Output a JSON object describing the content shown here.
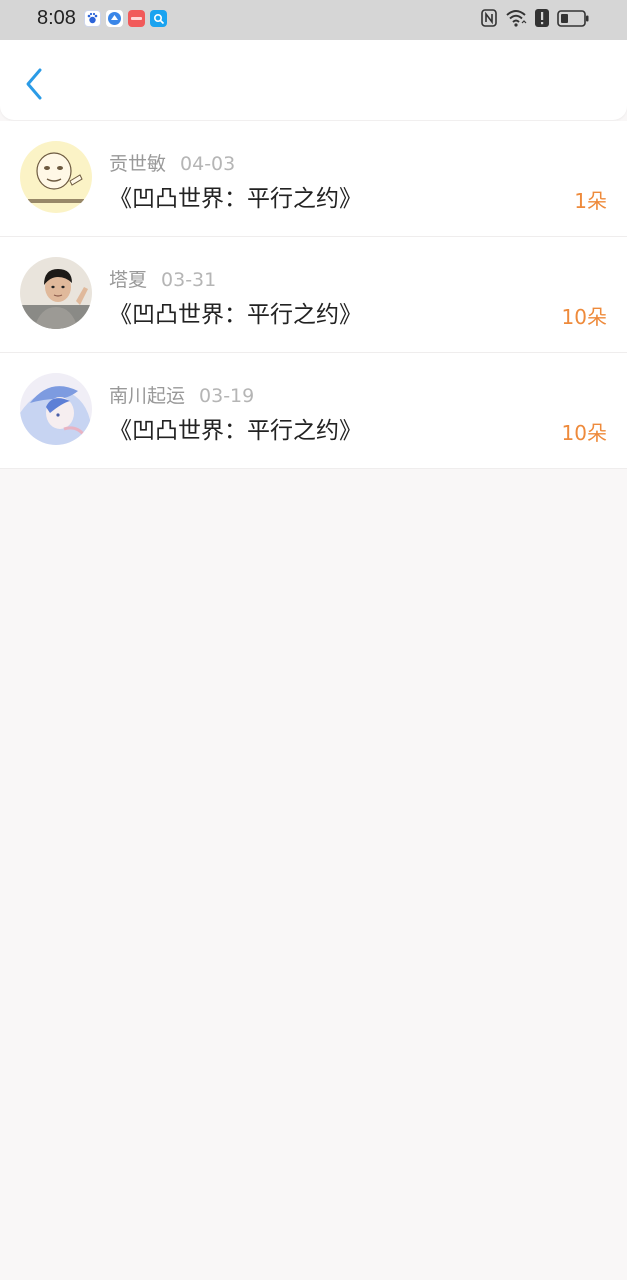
{
  "status_bar": {
    "time": "8:08",
    "notification_icons": [
      "baidu-icon",
      "blue-app-icon",
      "red-app-icon",
      "search-app-icon"
    ],
    "right_icons": [
      "nfc-icon",
      "wifi-icon",
      "alert-icon",
      "battery-icon"
    ]
  },
  "header": {
    "back_icon": "chevron-left-icon",
    "accent_color": "#2b9be6"
  },
  "list": {
    "count_color": "#ee8a3b",
    "items": [
      {
        "name": "贡世敏",
        "date": "04-03",
        "title": "《凹凸世界：平行之约》",
        "count": "1朵"
      },
      {
        "name": "塔夏",
        "date": "03-31",
        "title": "《凹凸世界：平行之约》",
        "count": "10朵"
      },
      {
        "name": "南川起运",
        "date": "03-19",
        "title": "《凹凸世界：平行之约》",
        "count": "10朵"
      }
    ]
  }
}
